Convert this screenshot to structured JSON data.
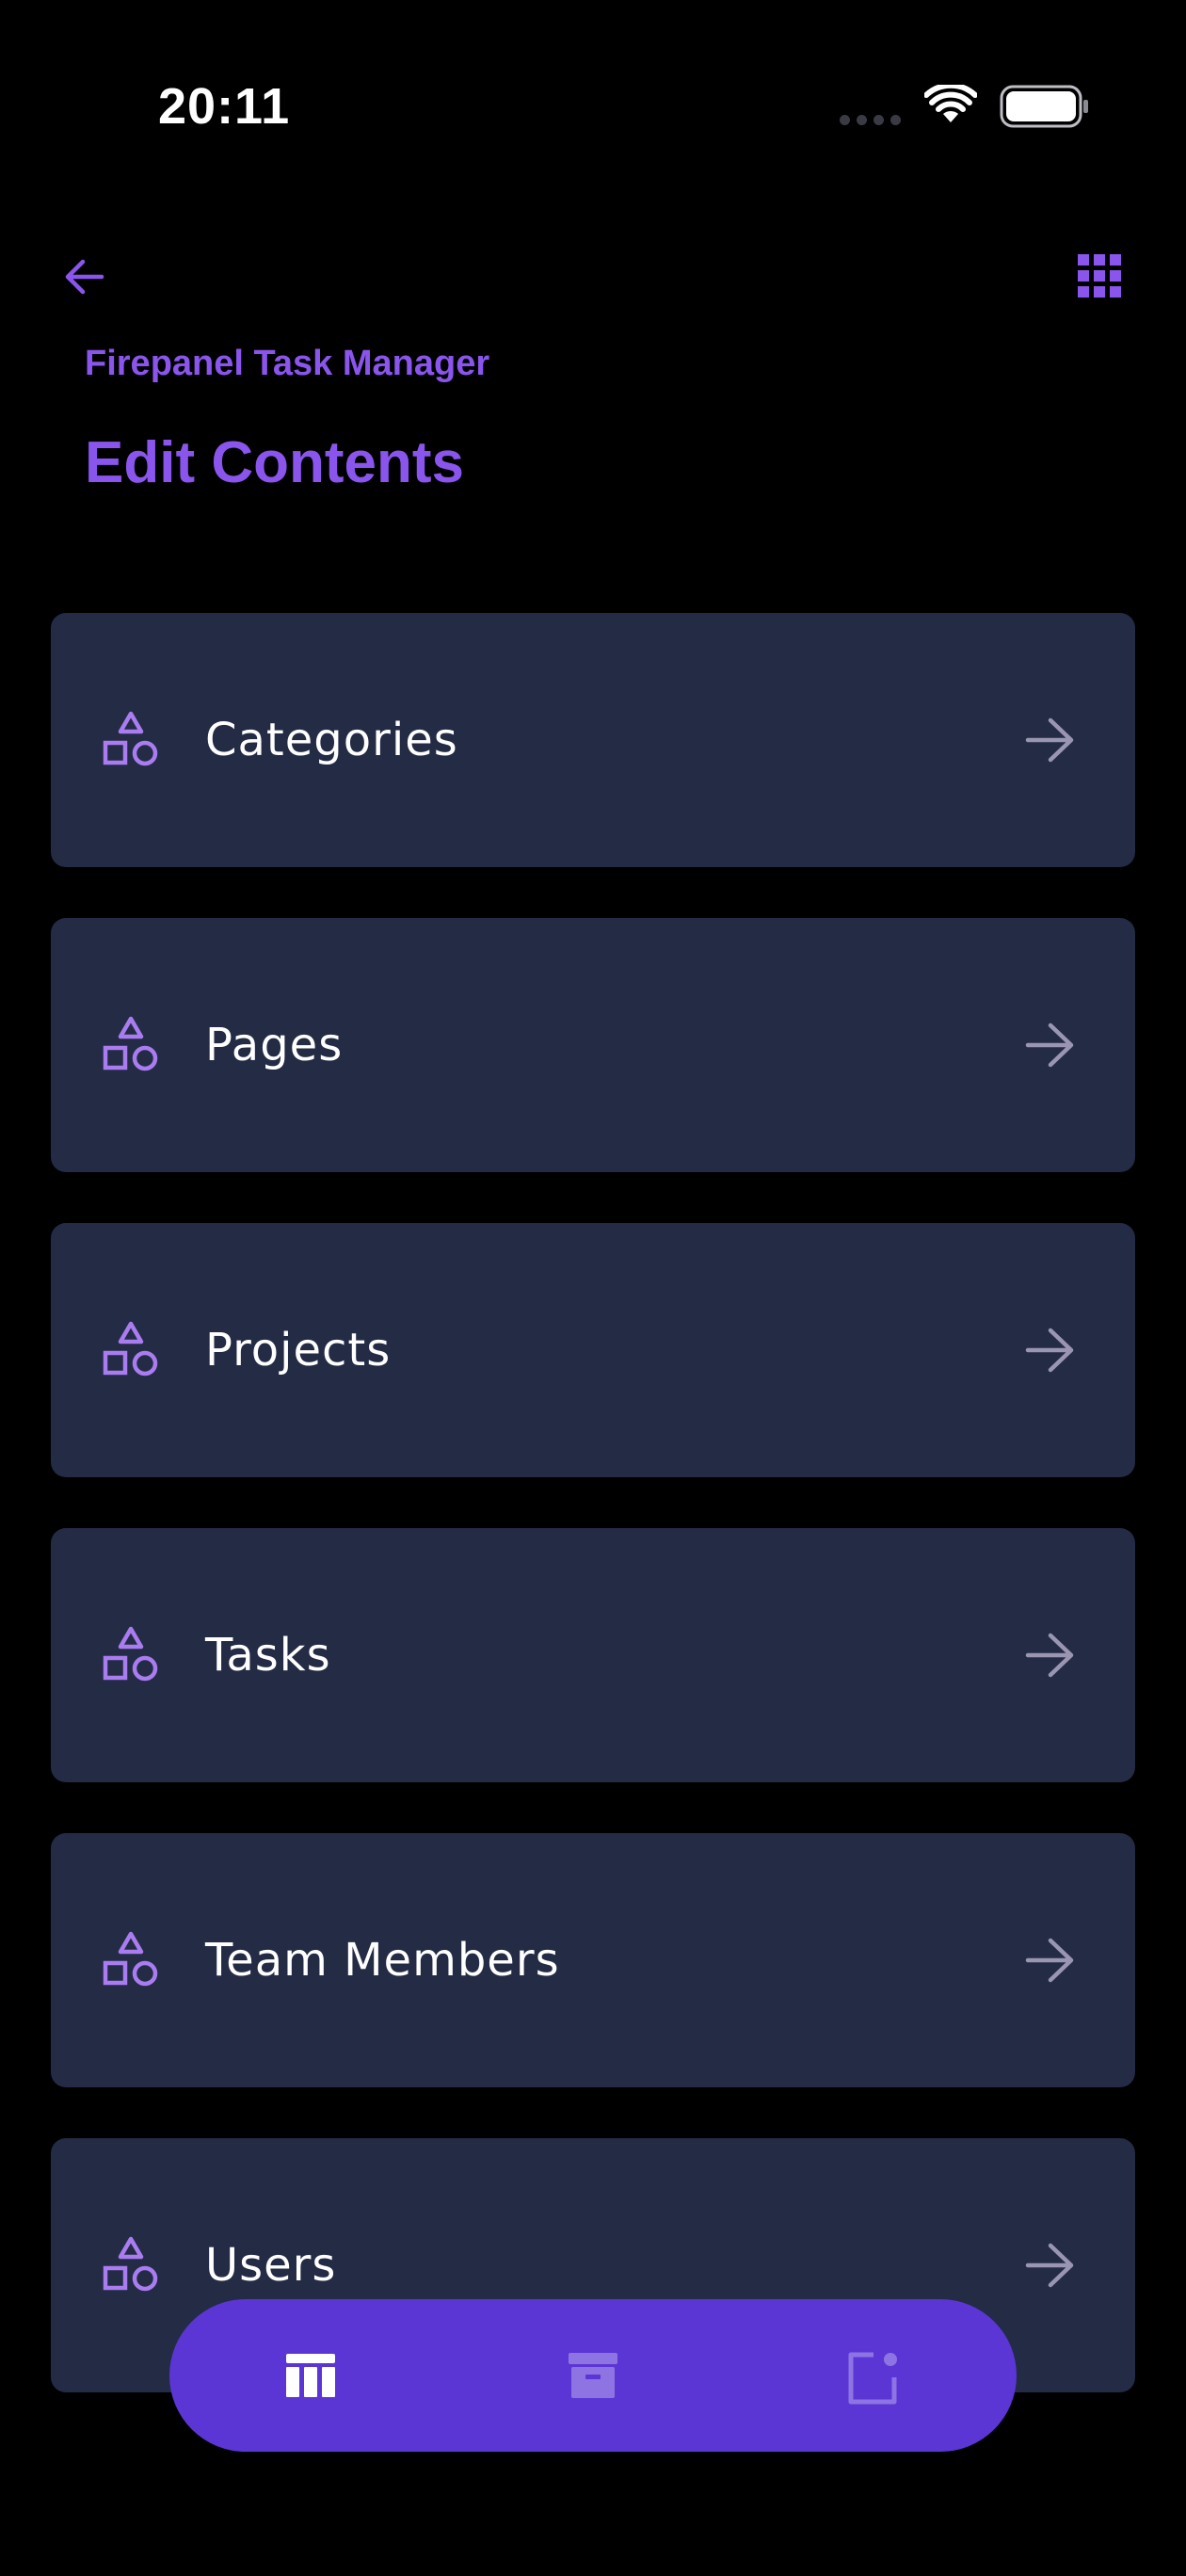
{
  "status_bar": {
    "time": "20:11"
  },
  "header": {
    "app_name": "Firepanel Task Manager",
    "title": "Edit Contents",
    "back_icon": "arrow-left-icon",
    "menu_icon": "grid-icon"
  },
  "content_list": {
    "items": [
      {
        "label": "Categories",
        "icon": "shapes-icon"
      },
      {
        "label": "Pages",
        "icon": "shapes-icon"
      },
      {
        "label": "Projects",
        "icon": "shapes-icon"
      },
      {
        "label": "Tasks",
        "icon": "shapes-icon"
      },
      {
        "label": "Team Members",
        "icon": "shapes-icon"
      },
      {
        "label": "Users",
        "icon": "shapes-icon"
      }
    ]
  },
  "bottom_nav": {
    "items": [
      {
        "icon": "table-icon",
        "active": true
      },
      {
        "icon": "archive-icon",
        "active": false
      },
      {
        "icon": "notification-square-icon",
        "active": false
      }
    ]
  },
  "colors": {
    "background": "#000000",
    "accent": "#8a55ec",
    "card": "#232b45",
    "nav": "#5b36d4"
  }
}
